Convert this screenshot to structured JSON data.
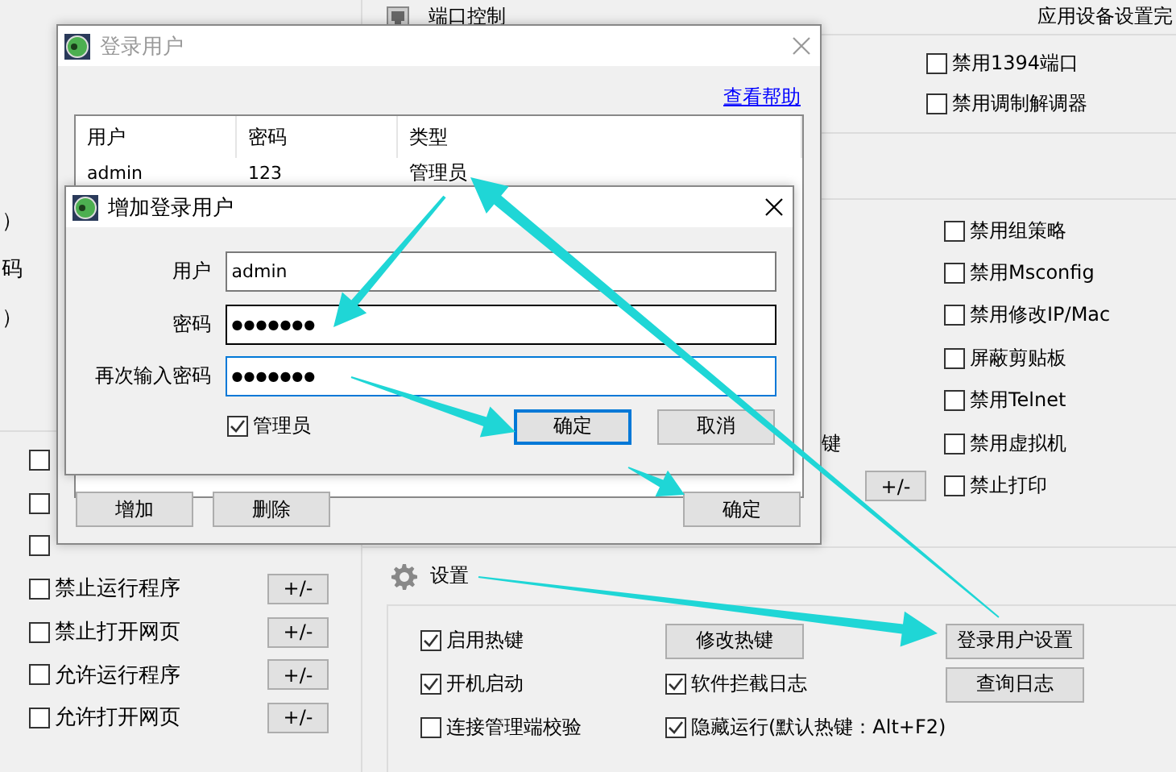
{
  "background": {
    "header": {
      "section_title": "端口控制",
      "right_text": "应用设备设置完"
    },
    "left_fragments": [
      "）",
      "码",
      "）"
    ],
    "device_options_top": [
      {
        "label": "禁用1394端口",
        "checked": false
      },
      {
        "label": "禁用调制解调器",
        "checked": false
      }
    ],
    "device_options": [
      {
        "label": "禁用组策略",
        "checked": false
      },
      {
        "label": "禁用Msconfig",
        "checked": false
      },
      {
        "label": "禁用修改IP/Mac",
        "checked": false
      },
      {
        "label": "屏蔽剪贴板",
        "checked": false
      },
      {
        "label": "禁用Telnet",
        "checked": false
      },
      {
        "label": "禁用虚拟机",
        "checked": false
      },
      {
        "label": "禁止打印",
        "checked": false
      }
    ],
    "hotkey_fragment": "键",
    "device_button": "+/-",
    "program_rules": [
      {
        "checked": false
      },
      {
        "checked": false
      },
      {
        "checked": false
      },
      {
        "label": "禁止运行程序",
        "checked": false,
        "button": "+/-"
      },
      {
        "label": "禁止打开网页",
        "checked": false,
        "button": "+/-"
      },
      {
        "label": "允许运行程序",
        "checked": false,
        "button": "+/-"
      },
      {
        "label": "允许打开网页",
        "checked": false,
        "button": "+/-"
      }
    ],
    "settings": {
      "title": "设置",
      "columns": [
        [
          {
            "kind": "checkbox",
            "label": "启用热键",
            "checked": true
          },
          {
            "kind": "checkbox",
            "label": "开机启动",
            "checked": true
          },
          {
            "kind": "checkbox",
            "label": "连接管理端校验",
            "checked": false
          }
        ],
        [
          {
            "kind": "button",
            "label": "修改热键"
          },
          {
            "kind": "checkbox",
            "label": "软件拦截日志",
            "checked": true
          },
          {
            "kind": "checkbox",
            "label": "隐藏运行(默认热键：Alt+F2)",
            "checked": true
          }
        ],
        [
          {
            "kind": "button",
            "label": "登录用户设置"
          },
          {
            "kind": "button",
            "label": "查询日志"
          }
        ]
      ]
    }
  },
  "login_dialog": {
    "title": "登录用户",
    "active": false,
    "help_link": "查看帮助",
    "columns": [
      "用户",
      "密码",
      "类型"
    ],
    "rows": [
      [
        "admin",
        "123",
        "管理员"
      ]
    ],
    "buttons": [
      "增加",
      "删除"
    ],
    "ok_button": "确定"
  },
  "add_dialog": {
    "title": "增加登录用户",
    "active": true,
    "fields": [
      {
        "label": "用户",
        "value": "admin",
        "focused": false,
        "hovered": false
      },
      {
        "label": "密码",
        "value": "●●●●●●●",
        "focused": false,
        "hovered": true
      },
      {
        "label": "再次输入密码",
        "value": "●●●●●●●",
        "focused": true,
        "hovered": false
      }
    ],
    "admin_checkbox": {
      "label": "管理员",
      "checked": true
    },
    "buttons": [
      {
        "label": "确定",
        "default": true
      },
      {
        "label": "取消",
        "default": false
      }
    ]
  }
}
